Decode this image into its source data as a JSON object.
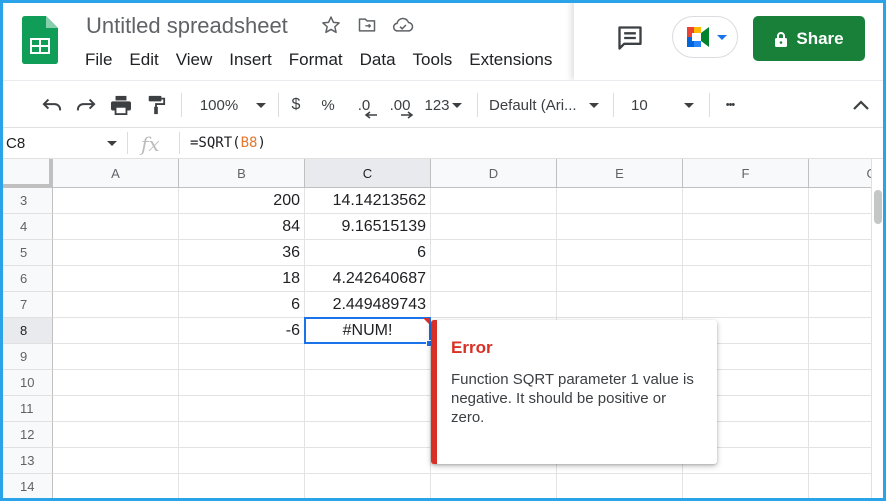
{
  "header": {
    "title": "Untitled spreadsheet",
    "menu": [
      "File",
      "Edit",
      "View",
      "Insert",
      "Format",
      "Data",
      "Tools",
      "Extensions"
    ],
    "share_label": "Share"
  },
  "toolbar": {
    "zoom": "100%",
    "currency": "$",
    "percent": "%",
    "dec_decrease": ".0",
    "dec_increase": ".00",
    "more_formats": "123",
    "font": "Default (Ari...",
    "font_size": "10",
    "more": "•••"
  },
  "formula_bar": {
    "cell_ref": "C8",
    "fx": "fx",
    "formula_prefix": "=SQRT(",
    "formula_ref": "B8",
    "formula_suffix": ")"
  },
  "grid": {
    "columns": [
      "A",
      "B",
      "C",
      "D",
      "E",
      "F",
      "G"
    ],
    "selected_column": "C",
    "rows": [
      {
        "num": "3",
        "b": "200",
        "c": "14.14213562"
      },
      {
        "num": "4",
        "b": "84",
        "c": "9.16515139"
      },
      {
        "num": "5",
        "b": "36",
        "c": "6"
      },
      {
        "num": "6",
        "b": "18",
        "c": "4.242640687"
      },
      {
        "num": "7",
        "b": "6",
        "c": "2.449489743"
      },
      {
        "num": "8",
        "b": "-6",
        "c": "#NUM!"
      },
      {
        "num": "9",
        "b": "",
        "c": ""
      },
      {
        "num": "10",
        "b": "",
        "c": ""
      },
      {
        "num": "11",
        "b": "",
        "c": ""
      },
      {
        "num": "12",
        "b": "",
        "c": ""
      },
      {
        "num": "13",
        "b": "",
        "c": ""
      },
      {
        "num": "14",
        "b": "",
        "c": ""
      }
    ],
    "selected_row": "8"
  },
  "error_popup": {
    "title": "Error",
    "message": "Function SQRT parameter 1 value is negative. It should be positive or zero."
  },
  "colors": {
    "sheets_green": "#0f9d58",
    "share_green": "#188038",
    "selection_blue": "#1a73e8",
    "error_red": "#d93025"
  }
}
